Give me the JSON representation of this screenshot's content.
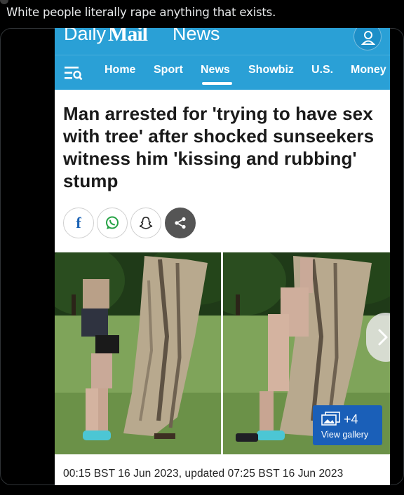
{
  "tweet": {
    "text": "White people literally rape anything that exists."
  },
  "article": {
    "masthead": {
      "daily": "Daily",
      "mail": "Mail",
      "news": "News"
    },
    "nav": {
      "items": [
        {
          "label": "Home"
        },
        {
          "label": "Sport"
        },
        {
          "label": "News",
          "active": true
        },
        {
          "label": "Showbiz"
        },
        {
          "label": "U.S."
        },
        {
          "label": "Money"
        }
      ]
    },
    "headline": "Man arrested for 'trying to have sex with tree' after shocked sunseekers witness him 'kissing and rubbing' stump",
    "share_buttons": [
      "facebook-icon",
      "whatsapp-icon",
      "snapchat-icon",
      "share-icon"
    ],
    "gallery": {
      "more_count": "+4",
      "view_label": "View gallery"
    },
    "timestamp": "00:15 BST 16 Jun 2023, updated 07:25 BST 16 Jun 2023"
  },
  "colors": {
    "brand_blue": "#2aa0d6",
    "gallery_button": "#1a5fb8",
    "facebook": "#1a62b4",
    "whatsapp": "#25a244"
  }
}
